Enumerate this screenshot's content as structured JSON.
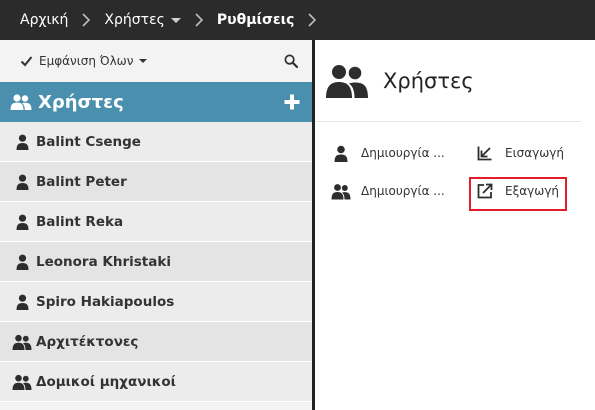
{
  "breadcrumb": {
    "items": [
      {
        "label": "Αρχική"
      },
      {
        "label": "Χρήστες"
      },
      {
        "label": "Ρυθμίσεις"
      }
    ]
  },
  "sidebar": {
    "filter_label": "Εμφάνιση Όλων",
    "header_title": "Χρήστες",
    "items": [
      {
        "label": "Balint Csenge",
        "icon": "user-icon"
      },
      {
        "label": "Balint Peter",
        "icon": "user-icon"
      },
      {
        "label": "Balint Reka",
        "icon": "user-icon"
      },
      {
        "label": "Leonora Khristaki",
        "icon": "user-icon"
      },
      {
        "label": "Spiro Hakiapoulos",
        "icon": "user-icon"
      },
      {
        "label": "Αρχιτέκτονες",
        "icon": "users-group-icon"
      },
      {
        "label": "Δομικοί μηχανικοί",
        "icon": "users-group-icon"
      }
    ]
  },
  "main": {
    "title": "Χρήστες",
    "actions": {
      "create_user": "Δημιουργία ...",
      "import": "Εισαγωγή",
      "create_group": "Δημιουργία ...",
      "export": "Εξαγωγή"
    }
  },
  "colors": {
    "topbar": "#2b2b2b",
    "list_header": "#4a8fae",
    "highlight": "#e21e26"
  }
}
